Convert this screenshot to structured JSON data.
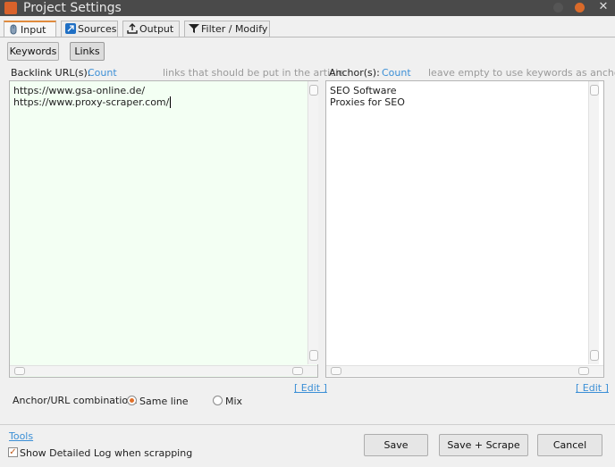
{
  "window": {
    "title": "Project Settings",
    "close_glyph": "✕"
  },
  "tabs": [
    {
      "label": "Input",
      "icon": "mouse-icon"
    },
    {
      "label": "Sources",
      "icon": "sources-icon"
    },
    {
      "label": "Output",
      "icon": "upload-icon"
    },
    {
      "label": "Filter / Modify",
      "icon": "filter-icon"
    }
  ],
  "subtabs": {
    "keywords": "Keywords",
    "links": "Links"
  },
  "backlinks": {
    "label": "Backlink URL(s):",
    "count_link": "Count",
    "hint": "links that should be put in the article",
    "lines": [
      "https://www.gsa-online.de/",
      "https://www.proxy-scraper.com/"
    ],
    "edit_link": "[ Edit ]"
  },
  "anchors": {
    "label": "Anchor(s):",
    "count_link": "Count",
    "hint": "leave empty to use keywords as anchors",
    "lines": [
      "SEO Software",
      "Proxies for SEO"
    ],
    "edit_link": "[ Edit ]"
  },
  "combination": {
    "label": "Anchor/URL combination:",
    "same_line": "Same line",
    "mix": "Mix",
    "selected": "Same line"
  },
  "footer": {
    "tools_link": "Tools",
    "detailed_log": "Show Detailed Log when scrapping",
    "detailed_log_checked": true,
    "save": "Save",
    "save_scrape": "Save + Scrape",
    "cancel": "Cancel"
  },
  "colors": {
    "accent": "#e0702a",
    "link": "#3b8fd6",
    "textarea_bg": "#f3fff3",
    "titlebar": "#4a4a4a"
  }
}
